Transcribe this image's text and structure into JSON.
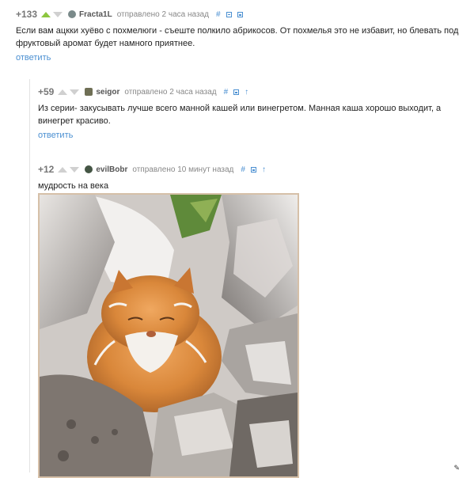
{
  "comments": [
    {
      "rating": "+133",
      "author": "Fracta1L",
      "status": "отправлено",
      "time": "2 часа назад",
      "link_icon": "#",
      "text": "Если вам ацкки хуёво с похмелюги - съеште полкило абрикосов. От похмелья это не избавит, но блевать под фруктовый аромат будет намного приятнее.",
      "reply": "ответить",
      "vote_up_active": true
    },
    {
      "rating": "+59",
      "author": "seigor",
      "status": "отправлено",
      "time": "2 часа назад",
      "link_icon": "#",
      "text": "Из серии- закусывать лучше всего манной кашей или винегретом. Манная каша хорошо выходит, а винегрет красиво.",
      "reply": "ответить"
    },
    {
      "rating": "+12",
      "author": "evilBobr",
      "status": "отправлено",
      "time": "10 минут назад",
      "link_icon": "#",
      "text": "мудрость на века"
    }
  ],
  "icons": {
    "vote_up": "triangle-up",
    "vote_down": "triangle-down",
    "collapse": "minus-square",
    "save": "save-square",
    "parent": "arrow-up"
  },
  "colors": {
    "accent": "#4a8fd1",
    "vote_active": "#8dc63f",
    "vote_inactive": "#d0d0d0",
    "frame": "#d6c0a8"
  },
  "image": {
    "subject": "orange cat with white whiskers among rocks"
  }
}
